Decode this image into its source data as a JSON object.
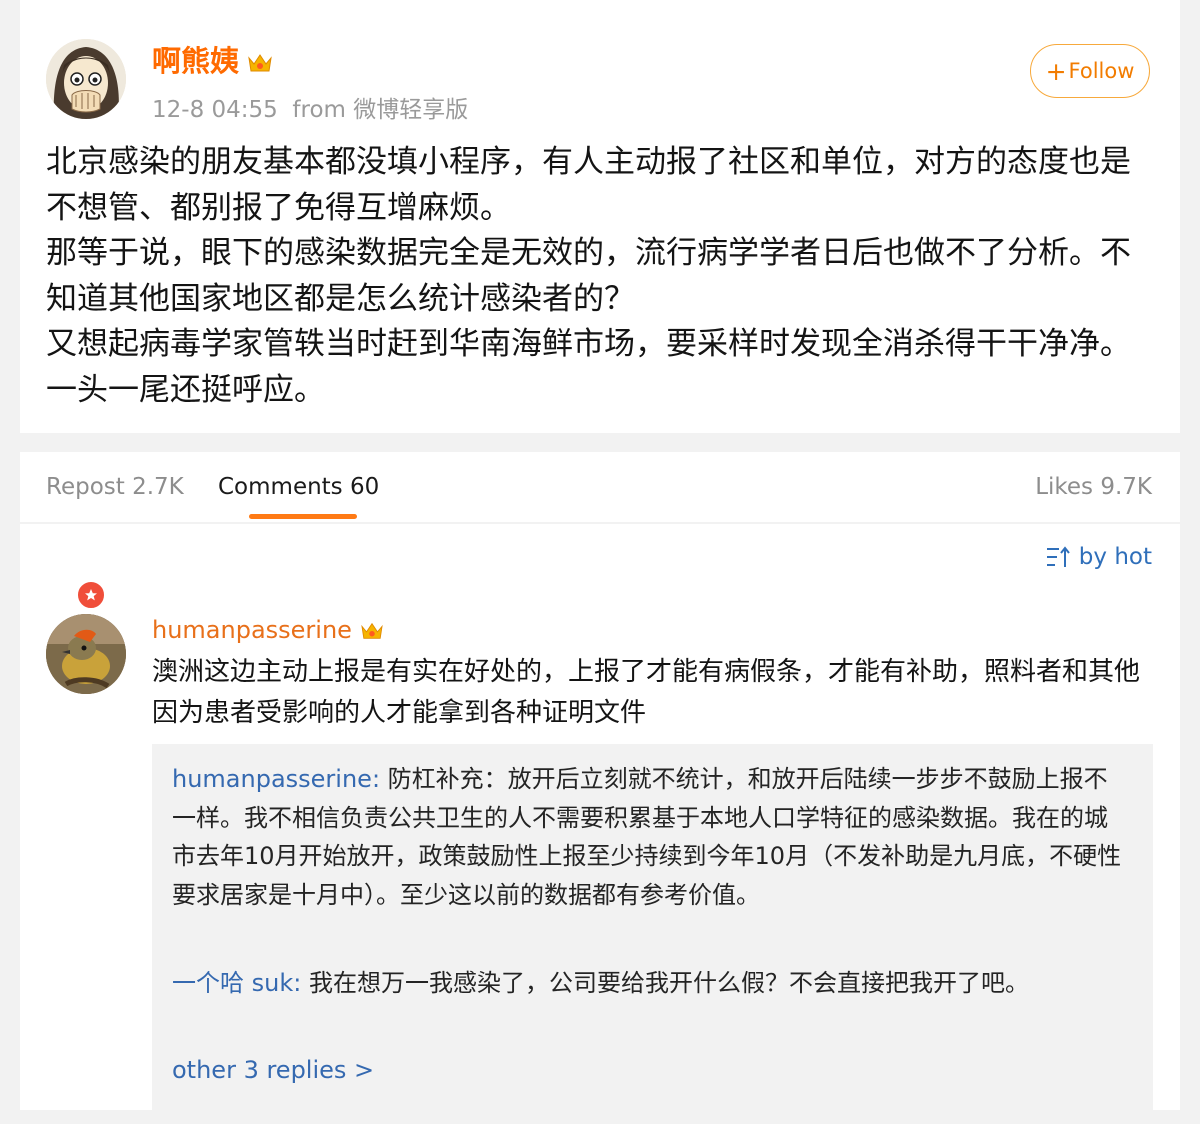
{
  "post": {
    "author": "啊熊姨",
    "timestamp": "12-8 04:55",
    "source": "from 微博轻享版",
    "follow_label": "Follow",
    "paragraphs": [
      "北京感染的朋友基本都没填小程序，有人主动报了社区和单位，对方的态度也是不想管、都别报了免得互增麻烦。",
      "那等于说，眼下的感染数据完全是无效的，流行病学学者日后也做不了分析。不知道其他国家地区都是怎么统计感染者的？",
      "又想起病毒学家管轶当时赶到华南海鲜市场，要采样时发现全消杀得干干净净。一头一尾还挺呼应。"
    ]
  },
  "tabs": {
    "repost": "Repost 2.7K",
    "comments": "Comments 60",
    "likes": "Likes 9.7K"
  },
  "sort_label": "by hot",
  "comment": {
    "author": "humanpasserine",
    "text": "澳洲这边主动上报是有实在好处的，上报了才能有病假条，才能有补助，照料者和其他因为患者受影响的人才能拿到各种证明文件",
    "replies": [
      {
        "author": "humanpasserine:",
        "text": " 防杠补充：放开后立刻就不统计，和放开后陆续一步步不鼓励上报不一样。我不相信负责公共卫生的人不需要积累基于本地人口学特征的感染数据。我在的城市去年10月开始放开，政策鼓励性上报至少持续到今年10月（不发补助是九月底，不硬性要求居家是十月中）。至少这以前的数据都有参考价值。"
      },
      {
        "author": "一个哈 suk:",
        "text": " 我在想万一我感染了，公司要给我开什么假？不会直接把我开了吧。"
      }
    ],
    "more_replies": "other 3 replies >"
  },
  "colors": {
    "accent_orange": "#ff6a00",
    "link_blue": "#3569b0",
    "tab_underline": "#ff7a14",
    "verified_badge": "#f04e3a"
  }
}
